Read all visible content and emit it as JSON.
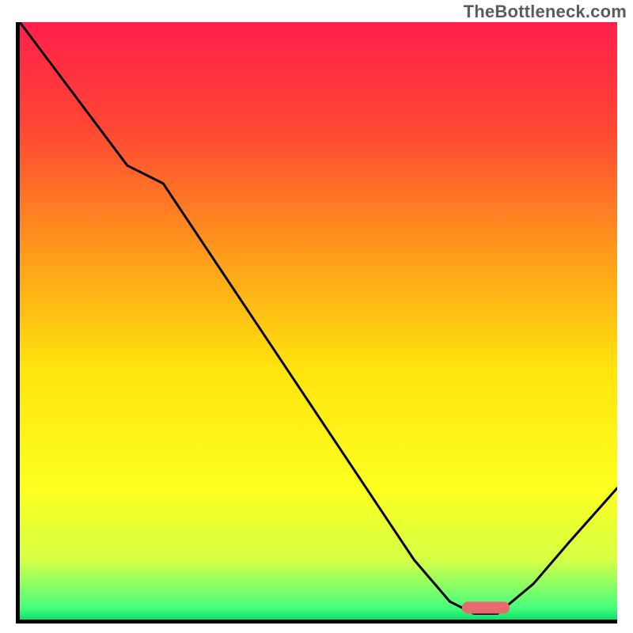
{
  "watermark": "TheBottleneck.com",
  "chart_data": {
    "type": "line",
    "title": "",
    "xlabel": "",
    "ylabel": "",
    "xlim": [
      0,
      100
    ],
    "ylim": [
      0,
      100
    ],
    "grid": false,
    "legend": false,
    "background_gradient": {
      "direction": "vertical",
      "stops": [
        {
          "pos": 0.0,
          "color": "#ff1f4b"
        },
        {
          "pos": 0.18,
          "color": "#ff4733"
        },
        {
          "pos": 0.4,
          "color": "#ffa01a"
        },
        {
          "pos": 0.58,
          "color": "#ffe40d"
        },
        {
          "pos": 0.78,
          "color": "#fcff1f"
        },
        {
          "pos": 0.9,
          "color": "#d6ff45"
        },
        {
          "pos": 0.98,
          "color": "#49ff7e"
        },
        {
          "pos": 1.0,
          "color": "#09e26a"
        }
      ]
    },
    "series": [
      {
        "name": "bottleneck-curve",
        "color": "#000000",
        "x": [
          0,
          6,
          12,
          18,
          24,
          30,
          36,
          42,
          48,
          54,
          60,
          66,
          72,
          76,
          80,
          86,
          92,
          100
        ],
        "y": [
          100,
          92,
          84,
          76,
          73,
          64,
          55,
          46,
          37,
          28,
          19,
          10,
          3,
          1,
          1,
          6,
          13,
          22
        ]
      }
    ],
    "annotations": [
      {
        "name": "optimal-marker",
        "shape": "rounded-rect",
        "color": "#e76a6f",
        "x_range": [
          74,
          82
        ],
        "y": 1,
        "height": 2
      }
    ]
  }
}
